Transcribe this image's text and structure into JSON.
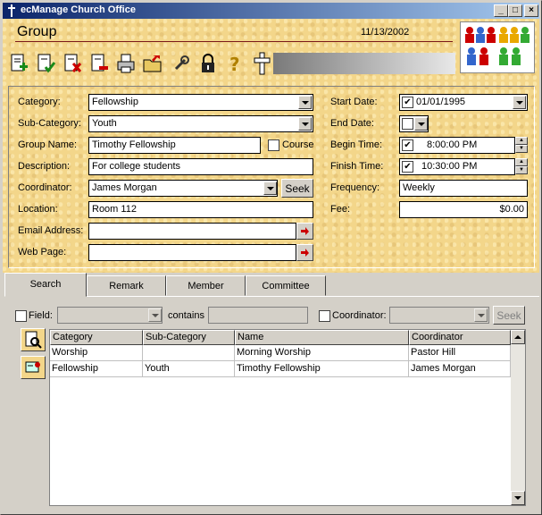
{
  "window": {
    "title": "ecManage Church Office",
    "controls": {
      "minimize": "_",
      "maximize": "□",
      "close": "×"
    }
  },
  "header": {
    "title": "Group",
    "date": "11/13/2002"
  },
  "toolbar": {
    "icons": [
      "new-document-icon",
      "approve-document-icon",
      "delete-document-icon",
      "remove-document-icon",
      "print-icon",
      "export-folder-icon",
      "tools-icon",
      "lock-icon",
      "help-icon",
      "cross-icon"
    ]
  },
  "form": {
    "category": {
      "label": "Category:",
      "value": "Fellowship"
    },
    "subcategory": {
      "label": "Sub-Category:",
      "value": "Youth"
    },
    "group_name": {
      "label": "Group Name:",
      "value": "Timothy Fellowship"
    },
    "course": {
      "label": "Course",
      "checked": false
    },
    "description": {
      "label": "Description:",
      "value": "For college students"
    },
    "coordinator": {
      "label": "Coordinator:",
      "value": "James Morgan",
      "seek": "Seek"
    },
    "location": {
      "label": "Location:",
      "value": "Room 112"
    },
    "email": {
      "label": "Email Address:",
      "value": ""
    },
    "webpage": {
      "label": "Web Page:",
      "value": ""
    },
    "start_date": {
      "label": "Start Date:",
      "value": "01/01/1995",
      "checked": true
    },
    "end_date": {
      "label": "End Date:",
      "value": "",
      "checked": false
    },
    "begin_time": {
      "label": "Begin Time:",
      "value": "8:00:00 PM",
      "checked": true
    },
    "finish_time": {
      "label": "Finish Time:",
      "value": "10:30:00 PM",
      "checked": true
    },
    "frequency": {
      "label": "Frequency:",
      "value": "Weekly"
    },
    "fee": {
      "label": "Fee:",
      "value": "$0.00"
    }
  },
  "tabs": [
    {
      "label": "Search",
      "active": true
    },
    {
      "label": "Remark",
      "active": false
    },
    {
      "label": "Member",
      "active": false
    },
    {
      "label": "Committee",
      "active": false
    }
  ],
  "search": {
    "field_label": "Field:",
    "contains_label": "contains",
    "coordinator_label": "Coordinator:",
    "seek_label": "Seek"
  },
  "grid": {
    "columns": [
      "Category",
      "Sub-Category",
      "Name",
      "Coordinator"
    ],
    "rows": [
      [
        "Worship",
        "",
        "Morning Worship",
        "Pastor Hill"
      ],
      [
        "Fellowship",
        "Youth",
        "Timothy Fellowship",
        "James Morgan"
      ]
    ]
  },
  "colors": {
    "titlebar": "#0a246a",
    "parchment": "#f3d68a",
    "accent_red": "#cc0000"
  }
}
